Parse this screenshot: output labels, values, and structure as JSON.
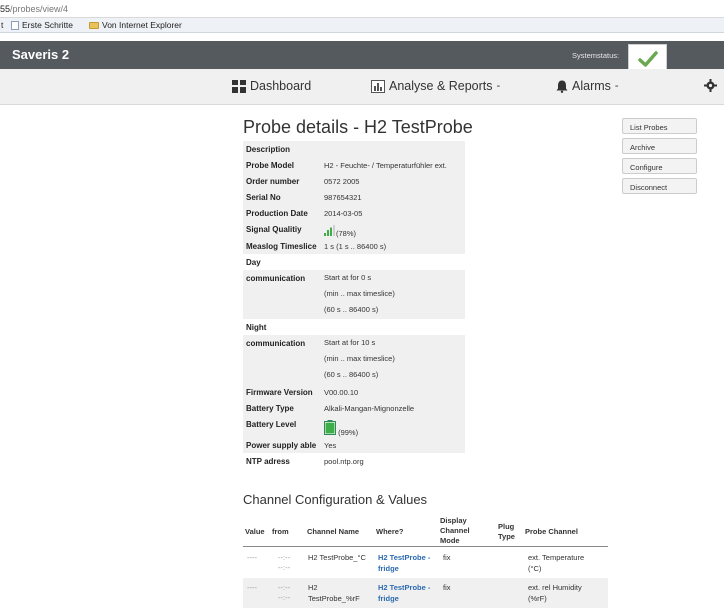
{
  "browser": {
    "url_host": "55",
    "url_path": "/probes/view/4",
    "favorites_prefix": "t",
    "favorites": [
      "Erste Schritte",
      "Von Internet Explorer"
    ]
  },
  "app": {
    "name": "Saveris 2",
    "status_label": "Systemstatus",
    "status_color": "#6aa84f"
  },
  "nav": {
    "dashboard": "Dashboard",
    "analyse": "Analyse & Reports",
    "alarms": "Alarms",
    "caret": "-"
  },
  "page": {
    "title": "Probe details - H2 TestProbe"
  },
  "details": {
    "description_label": "Description",
    "probe_model_label": "Probe Model",
    "probe_model": "H2 - Feuchte- / Temperaturfühler ext.",
    "order_number_label": "Order number",
    "order_number": "0572 2005",
    "serial_label": "Serial No",
    "serial": "987654321",
    "production_date_label": "Production Date",
    "production_date": "2014-03-05",
    "signal_label": "Signal Qualitiy",
    "signal": "(78%)",
    "signal_level": 0.78,
    "measlog_label": "Measlog Timeslice",
    "measlog": "1 s (1 s .. 86400 s)",
    "day_label": "Day",
    "communication_label": "communication",
    "day_start": "Start at for 0 s",
    "day_minmax": "(min .. max timeslice)",
    "day_range": "(60 s .. 86400 s)",
    "night_label": "Night",
    "night_start": "Start at for 10 s",
    "night_minmax": "(min .. max timeslice)",
    "night_range": "(60 s .. 86400 s)",
    "firmware_label": "Firmware Version",
    "firmware": "V00.00.10",
    "battery_type_label": "Battery Type",
    "battery_type": "Alkali-Mangan-Mignonzelle",
    "battery_level_label": "Battery Level",
    "battery_level": "(99%)",
    "battery_fraction": 0.99,
    "power_label": "Power supply able",
    "power": "Yes",
    "ntp_label": "NTP adress",
    "ntp": "pool.ntp.org"
  },
  "actions": {
    "list": "List Probes",
    "archive": "Archive",
    "configure": "Configure",
    "disconnect": "Disconnect"
  },
  "channels": {
    "title": "Channel Configuration & Values",
    "headers": {
      "value": "Value",
      "from": "from",
      "name": "Channel Name",
      "where": "Where?",
      "display1": "Display",
      "display2": "Channel",
      "display3": "Mode",
      "plug1": "Plug",
      "plug2": "Type",
      "probe_channel": "Probe Channel"
    },
    "rows": [
      {
        "value": "----",
        "from1": "--:--",
        "from2": "--:--",
        "name1": "H2 TestProbe_°C",
        "name2": "",
        "where1": "H2 TestProbe -",
        "where2": "fridge",
        "mode": "fix",
        "probe1": "ext. Temperature",
        "probe2": "(°C)"
      },
      {
        "value": "----",
        "from1": "--:--",
        "from2": "--:--",
        "name1": "H2",
        "name2": "TestProbe_%rF",
        "where1": "H2 TestProbe -",
        "where2": "fridge",
        "mode": "fix",
        "probe1": "ext. rel Humidity",
        "probe2": "(%rF)"
      }
    ]
  }
}
